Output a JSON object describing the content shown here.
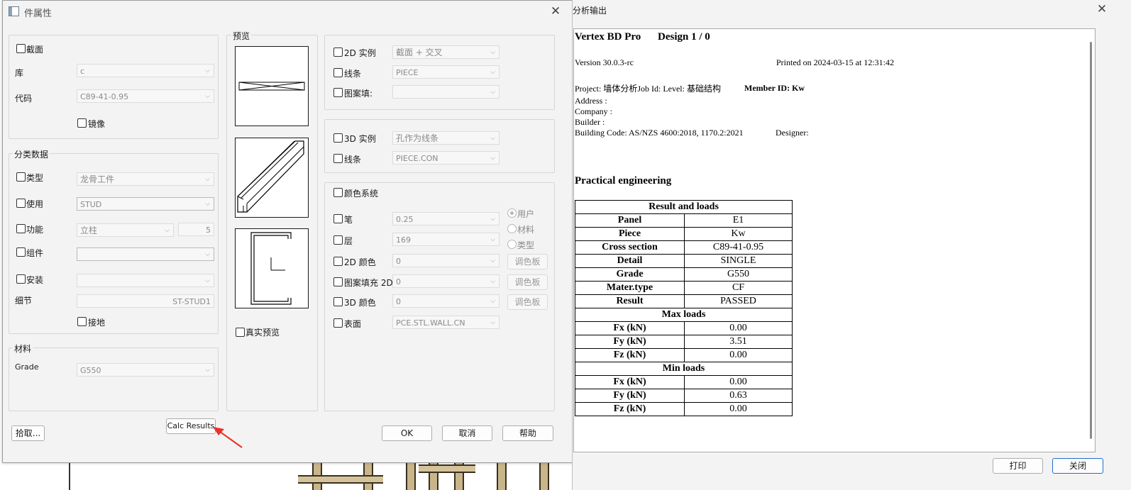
{
  "left_dialog": {
    "title": "件属性",
    "section": {
      "checkbox": "截面",
      "library_label": "库",
      "library_value": "c",
      "code_label": "代码",
      "code_value": "C89-41-0.95",
      "mirror": "镜像"
    },
    "classification": {
      "title": "分类数据",
      "type_label": "类型",
      "type_value": "龙骨工件",
      "use_label": "使用",
      "use_value": "STUD",
      "function_label": "功能",
      "function_value": "立柱",
      "function_number": "5",
      "group_label": "组件",
      "group_value": "",
      "install_label": "安装",
      "install_value": "",
      "detail_label": "细节",
      "detail_value": "ST-STUD1",
      "ground": "接地"
    },
    "material": {
      "title": "材料",
      "grade_label": "Grade",
      "grade_value": "G550"
    },
    "preview": {
      "title": "预览",
      "real_preview": "真实预览"
    },
    "display2d": {
      "instance": "2D 实例",
      "instance_value": "截面 + 交叉",
      "lines": "线条",
      "lines_value": "PIECE",
      "hatch": "图案填:",
      "hatch_value": ""
    },
    "display3d": {
      "instance": "3D 实例",
      "instance_value": "孔作为线条",
      "lines": "线条",
      "lines_value": "PIECE.CON"
    },
    "color_system": {
      "title": "颜色系统",
      "pen": "笔",
      "pen_value": "0.25",
      "layer": "层",
      "layer_value": "169",
      "color2d": "2D 颜色",
      "color2d_value": "0",
      "hatch2d": "图案填充 2D",
      "hatch2d_value": "0",
      "color3d": "3D 颜色",
      "color3d_value": "0",
      "surface": "表面",
      "surface_value": "PCE.STL.WALL.CN",
      "radio_user": "用户",
      "radio_material": "材料",
      "radio_type": "类型",
      "palette": "调色板"
    },
    "buttons": {
      "pick": "拾取...",
      "calc": "Calc Results",
      "ok": "OK",
      "cancel": "取消",
      "help": "帮助"
    }
  },
  "right_dialog": {
    "title": "分析输出",
    "report": {
      "heading1": "Vertex BD Pro",
      "heading2": "Design 1 / 0",
      "version": "Version 30.0.3-rc",
      "printed": "Printed on 2024-03-15 at 12:31:42",
      "project": "Project: 墙体分析Job Id:   Level: 基础结构",
      "member_id": "Member ID: Kw",
      "address": "Address :",
      "company": "Company :",
      "builder": "Builder :",
      "building_code": "Building Code: AS/NZS 4600:2018, 1170.2:2021",
      "designer": "Designer:",
      "practical": "Practical engineering",
      "table_title": "Result and loads",
      "rows": [
        {
          "k": "Panel",
          "v": "E1"
        },
        {
          "k": "Piece",
          "v": "Kw"
        },
        {
          "k": "Cross section",
          "v": "C89-41-0.95"
        },
        {
          "k": "Detail",
          "v": "SINGLE"
        },
        {
          "k": "Grade",
          "v": "G550"
        },
        {
          "k": "Mater.type",
          "v": "CF"
        },
        {
          "k": "Result",
          "v": "PASSED"
        }
      ],
      "max_title": "Max loads",
      "max_rows": [
        {
          "k": "Fx (kN)",
          "v": "0.00"
        },
        {
          "k": "Fy (kN)",
          "v": "3.51"
        },
        {
          "k": "Fz (kN)",
          "v": "0.00"
        }
      ],
      "min_title": "Min loads",
      "min_rows": [
        {
          "k": "Fx (kN)",
          "v": "0.00"
        },
        {
          "k": "Fy (kN)",
          "v": "0.63"
        },
        {
          "k": "Fz (kN)",
          "v": "0.00"
        }
      ]
    },
    "buttons": {
      "print": "打印",
      "close": "关闭"
    }
  },
  "colors": {
    "accent_red": "#e8322a",
    "focus_blue": "#1f6fd1"
  }
}
